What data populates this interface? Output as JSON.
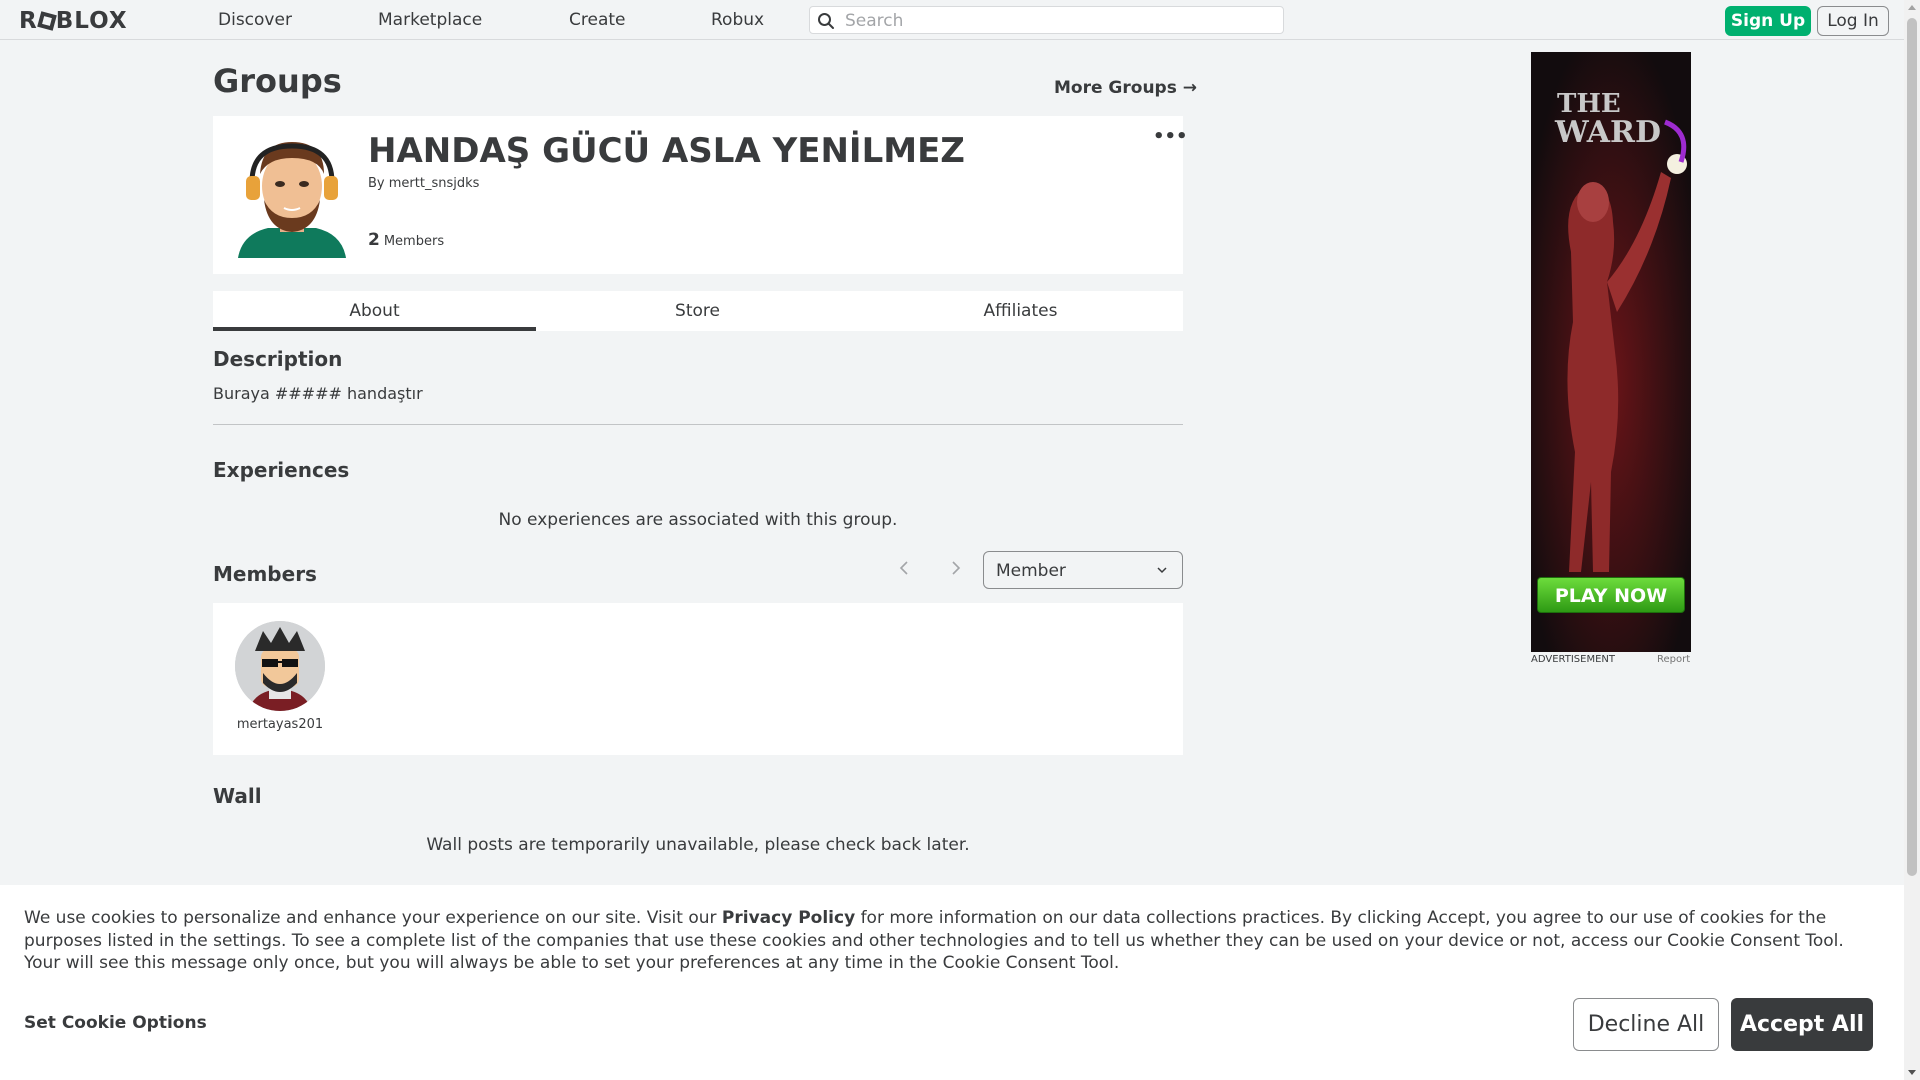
{
  "nav": {
    "logo": "ROBLOX",
    "links": [
      "Discover",
      "Marketplace",
      "Create",
      "Robux"
    ],
    "search_placeholder": "Search",
    "signup_label": "Sign Up",
    "login_label": "Log In"
  },
  "page": {
    "title": "Groups",
    "more_groups": "More Groups →"
  },
  "group": {
    "name": "HANDAŞ GÜCÜ ASLA YENİLMEZ",
    "by_prefix": "By",
    "owner": "mertt_snsjdks",
    "member_count": "2",
    "member_label": "Members",
    "menu_glyph": "•••"
  },
  "tabs": [
    "About",
    "Store",
    "Affiliates"
  ],
  "about": {
    "description_heading": "Description",
    "description": "Buraya ##### handaştır",
    "experiences_heading": "Experiences",
    "experiences_empty": "No experiences are associated with this group.",
    "members_heading": "Members",
    "role_selected": "Member",
    "members": [
      {
        "name": "mertayas201"
      }
    ],
    "wall_heading": "Wall",
    "wall_message": "Wall posts are temporarily unavailable, please check back later."
  },
  "ad": {
    "play_label": "PLAY NOW",
    "ad_label": "ADVERTISEMENT",
    "report_label": "Report"
  },
  "cookie": {
    "text_before": "We use cookies to personalize and enhance your experience on our site. Visit our ",
    "privacy_link": "Privacy Policy",
    "text_after": " for more information on our data collections practices. By clicking Accept, you agree to our use of cookies for the purposes listed in the settings. To see a complete list of the companies that use these cookies and other technologies and to tell us whether they can be used on your device or not, access our Cookie Consent Tool. Your will see this message only once, but you will always be able to set your preferences at any time in the Cookie Consent Tool.",
    "options_label": "Set Cookie Options",
    "decline_label": "Decline All",
    "accept_label": "Accept All"
  },
  "colors": {
    "signup_green": "#00b06f",
    "accept_dark": "#393b3d",
    "page_bg": "#f2f4f5"
  }
}
